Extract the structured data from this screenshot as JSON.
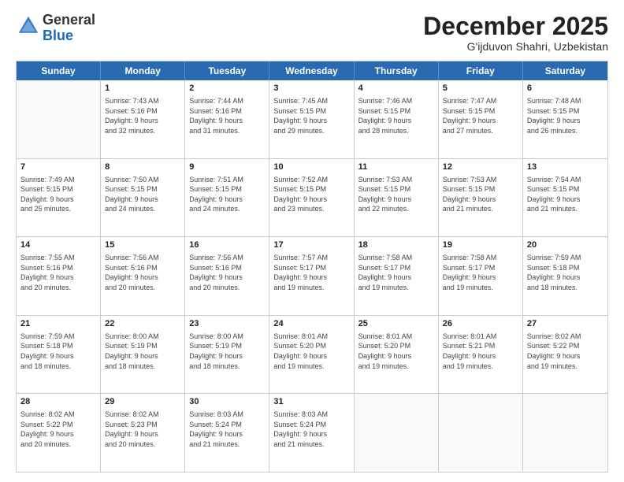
{
  "header": {
    "logo_general": "General",
    "logo_blue": "Blue",
    "month_title": "December 2025",
    "subtitle": "G'ijduvon Shahri, Uzbekistan"
  },
  "calendar": {
    "days_of_week": [
      "Sunday",
      "Monday",
      "Tuesday",
      "Wednesday",
      "Thursday",
      "Friday",
      "Saturday"
    ],
    "rows": [
      [
        {
          "day": "",
          "info": ""
        },
        {
          "day": "1",
          "info": "Sunrise: 7:43 AM\nSunset: 5:16 PM\nDaylight: 9 hours\nand 32 minutes."
        },
        {
          "day": "2",
          "info": "Sunrise: 7:44 AM\nSunset: 5:16 PM\nDaylight: 9 hours\nand 31 minutes."
        },
        {
          "day": "3",
          "info": "Sunrise: 7:45 AM\nSunset: 5:15 PM\nDaylight: 9 hours\nand 29 minutes."
        },
        {
          "day": "4",
          "info": "Sunrise: 7:46 AM\nSunset: 5:15 PM\nDaylight: 9 hours\nand 28 minutes."
        },
        {
          "day": "5",
          "info": "Sunrise: 7:47 AM\nSunset: 5:15 PM\nDaylight: 9 hours\nand 27 minutes."
        },
        {
          "day": "6",
          "info": "Sunrise: 7:48 AM\nSunset: 5:15 PM\nDaylight: 9 hours\nand 26 minutes."
        }
      ],
      [
        {
          "day": "7",
          "info": "Sunrise: 7:49 AM\nSunset: 5:15 PM\nDaylight: 9 hours\nand 25 minutes."
        },
        {
          "day": "8",
          "info": "Sunrise: 7:50 AM\nSunset: 5:15 PM\nDaylight: 9 hours\nand 24 minutes."
        },
        {
          "day": "9",
          "info": "Sunrise: 7:51 AM\nSunset: 5:15 PM\nDaylight: 9 hours\nand 24 minutes."
        },
        {
          "day": "10",
          "info": "Sunrise: 7:52 AM\nSunset: 5:15 PM\nDaylight: 9 hours\nand 23 minutes."
        },
        {
          "day": "11",
          "info": "Sunrise: 7:53 AM\nSunset: 5:15 PM\nDaylight: 9 hours\nand 22 minutes."
        },
        {
          "day": "12",
          "info": "Sunrise: 7:53 AM\nSunset: 5:15 PM\nDaylight: 9 hours\nand 21 minutes."
        },
        {
          "day": "13",
          "info": "Sunrise: 7:54 AM\nSunset: 5:15 PM\nDaylight: 9 hours\nand 21 minutes."
        }
      ],
      [
        {
          "day": "14",
          "info": "Sunrise: 7:55 AM\nSunset: 5:16 PM\nDaylight: 9 hours\nand 20 minutes."
        },
        {
          "day": "15",
          "info": "Sunrise: 7:56 AM\nSunset: 5:16 PM\nDaylight: 9 hours\nand 20 minutes."
        },
        {
          "day": "16",
          "info": "Sunrise: 7:56 AM\nSunset: 5:16 PM\nDaylight: 9 hours\nand 20 minutes."
        },
        {
          "day": "17",
          "info": "Sunrise: 7:57 AM\nSunset: 5:17 PM\nDaylight: 9 hours\nand 19 minutes."
        },
        {
          "day": "18",
          "info": "Sunrise: 7:58 AM\nSunset: 5:17 PM\nDaylight: 9 hours\nand 19 minutes."
        },
        {
          "day": "19",
          "info": "Sunrise: 7:58 AM\nSunset: 5:17 PM\nDaylight: 9 hours\nand 19 minutes."
        },
        {
          "day": "20",
          "info": "Sunrise: 7:59 AM\nSunset: 5:18 PM\nDaylight: 9 hours\nand 18 minutes."
        }
      ],
      [
        {
          "day": "21",
          "info": "Sunrise: 7:59 AM\nSunset: 5:18 PM\nDaylight: 9 hours\nand 18 minutes."
        },
        {
          "day": "22",
          "info": "Sunrise: 8:00 AM\nSunset: 5:19 PM\nDaylight: 9 hours\nand 18 minutes."
        },
        {
          "day": "23",
          "info": "Sunrise: 8:00 AM\nSunset: 5:19 PM\nDaylight: 9 hours\nand 18 minutes."
        },
        {
          "day": "24",
          "info": "Sunrise: 8:01 AM\nSunset: 5:20 PM\nDaylight: 9 hours\nand 19 minutes."
        },
        {
          "day": "25",
          "info": "Sunrise: 8:01 AM\nSunset: 5:20 PM\nDaylight: 9 hours\nand 19 minutes."
        },
        {
          "day": "26",
          "info": "Sunrise: 8:01 AM\nSunset: 5:21 PM\nDaylight: 9 hours\nand 19 minutes."
        },
        {
          "day": "27",
          "info": "Sunrise: 8:02 AM\nSunset: 5:22 PM\nDaylight: 9 hours\nand 19 minutes."
        }
      ],
      [
        {
          "day": "28",
          "info": "Sunrise: 8:02 AM\nSunset: 5:22 PM\nDaylight: 9 hours\nand 20 minutes."
        },
        {
          "day": "29",
          "info": "Sunrise: 8:02 AM\nSunset: 5:23 PM\nDaylight: 9 hours\nand 20 minutes."
        },
        {
          "day": "30",
          "info": "Sunrise: 8:03 AM\nSunset: 5:24 PM\nDaylight: 9 hours\nand 21 minutes."
        },
        {
          "day": "31",
          "info": "Sunrise: 8:03 AM\nSunset: 5:24 PM\nDaylight: 9 hours\nand 21 minutes."
        },
        {
          "day": "",
          "info": ""
        },
        {
          "day": "",
          "info": ""
        },
        {
          "day": "",
          "info": ""
        }
      ]
    ]
  }
}
